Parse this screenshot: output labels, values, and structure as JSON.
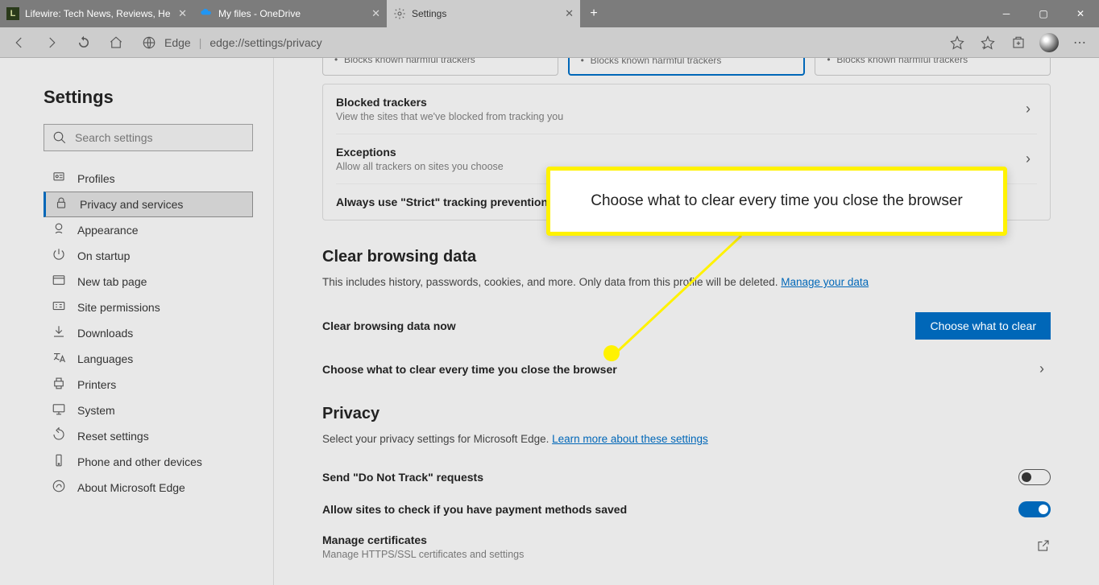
{
  "tabs": [
    {
      "label": "Lifewire: Tech News, Reviews, He",
      "active": false
    },
    {
      "label": "My files - OneDrive",
      "active": false
    },
    {
      "label": "Settings",
      "active": true
    }
  ],
  "addressbar": {
    "engine": "Edge",
    "url": "edge://settings/privacy"
  },
  "sidebar": {
    "title": "Settings",
    "search_placeholder": "Search settings",
    "items": [
      {
        "icon": "profile",
        "label": "Profiles"
      },
      {
        "icon": "lock",
        "label": "Privacy and services",
        "active": true
      },
      {
        "icon": "appearance",
        "label": "Appearance"
      },
      {
        "icon": "power",
        "label": "On startup"
      },
      {
        "icon": "newtab",
        "label": "New tab page"
      },
      {
        "icon": "permissions",
        "label": "Site permissions"
      },
      {
        "icon": "download",
        "label": "Downloads"
      },
      {
        "icon": "language",
        "label": "Languages"
      },
      {
        "icon": "printer",
        "label": "Printers"
      },
      {
        "icon": "system",
        "label": "System"
      },
      {
        "icon": "reset",
        "label": "Reset settings"
      },
      {
        "icon": "phone",
        "label": "Phone and other devices"
      },
      {
        "icon": "about",
        "label": "About Microsoft Edge"
      }
    ]
  },
  "tracking_cards": [
    {
      "bullet": "Blocks known harmful trackers",
      "selected": false
    },
    {
      "bullet": "Blocks known harmful trackers",
      "selected": true
    },
    {
      "bullet": "Blocks known harmful trackers",
      "selected": false
    }
  ],
  "tracking_rows": [
    {
      "title": "Blocked trackers",
      "sub": "View the sites that we've blocked from tracking you"
    },
    {
      "title": "Exceptions",
      "sub": "Allow all trackers on sites you choose"
    },
    {
      "title": "Always use \"Strict\" tracking prevention whe",
      "sub": ""
    }
  ],
  "clear": {
    "heading": "Clear browsing data",
    "desc_pre": "This includes history, passwords, cookies, and more. Only data from this profile will be deleted. ",
    "desc_link": "Manage your data",
    "now_label": "Clear browsing data now",
    "button": "Choose what to clear",
    "every_time": "Choose what to clear every time you close the browser"
  },
  "privacy": {
    "heading": "Privacy",
    "desc_pre": "Select your privacy settings for Microsoft Edge. ",
    "desc_link": "Learn more about these settings",
    "dnt": "Send \"Do Not Track\" requests",
    "payment": "Allow sites to check if you have payment methods saved",
    "certs_title": "Manage certificates",
    "certs_sub": "Manage HTTPS/SSL certificates and settings"
  },
  "callout": "Choose what to clear every time you close the browser"
}
